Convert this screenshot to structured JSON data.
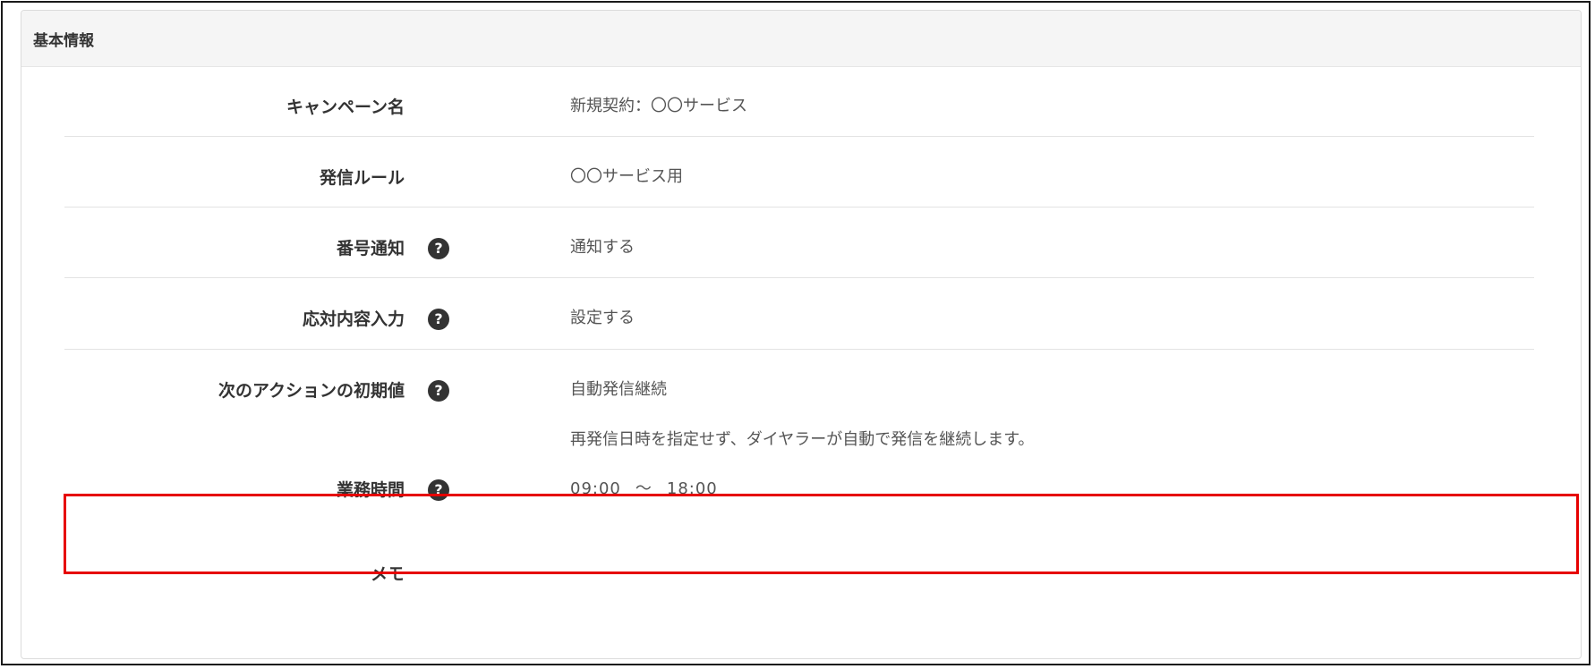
{
  "panel": {
    "title": "基本情報"
  },
  "rows": [
    {
      "label": "キャンペーン名",
      "value": "新規契約：〇〇サービス"
    },
    {
      "label": "発信ルール",
      "value": "〇〇サービス用"
    },
    {
      "label": "番号通知",
      "value": "通知する",
      "help_icon": "question-circle-icon"
    },
    {
      "label": "応対内容入力",
      "value": "設定する",
      "help_icon": "question-circle-icon"
    },
    {
      "label": "次のアクションの初期値",
      "value": "自動発信継続",
      "description": "再発信日時を指定せず、ダイヤラーが自動で発信を継続します。",
      "help_icon": "question-circle-icon"
    },
    {
      "label": "業務時間",
      "time_start": "09:00",
      "time_separator": "〜",
      "time_end": "18:00",
      "help_icon": "question-circle-icon"
    },
    {
      "label": "メモ",
      "value": ""
    }
  ],
  "help_icon_glyph": "?",
  "colors": {
    "highlight": "#e60000",
    "header_bg": "#f5f5f5",
    "icon_bg": "#333333"
  }
}
